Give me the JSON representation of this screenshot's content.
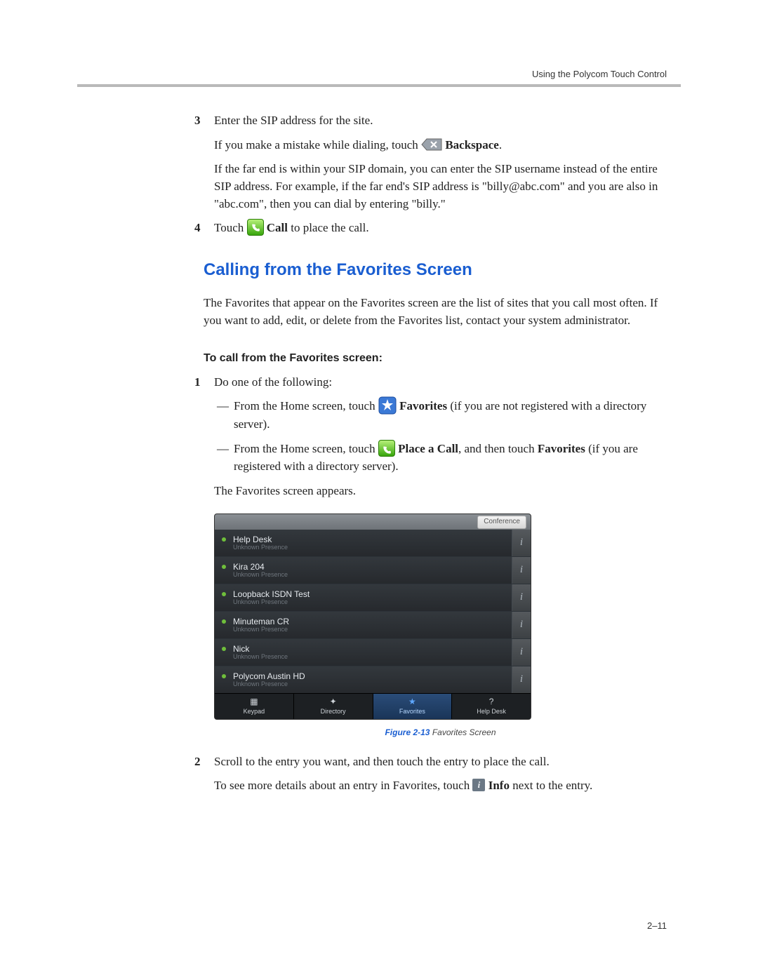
{
  "header": {
    "running": "Using the Polycom Touch Control"
  },
  "step3": {
    "num": "3",
    "p1": "Enter the SIP address for the site.",
    "p2a": "If you make a mistake while dialing, touch ",
    "p2b": "Backspace",
    "p2c": ".",
    "p3": "If the far end is within your SIP domain, you can enter the SIP username instead of the entire SIP address. For example, if the far end's SIP address is \"billy@abc.com\" and you are also in \"abc.com\", then you can dial by entering \"billy.\""
  },
  "step4": {
    "num": "4",
    "a": "Touch ",
    "b": "Call",
    "c": " to place the call."
  },
  "section": {
    "title": "Calling from the Favorites Screen",
    "intro": "The Favorites that appear on the Favorites screen are the list of sites that you call most often. If you want to add, edit, or delete from the Favorites list, contact your system administrator.",
    "subhead": "To call from the Favorites screen:"
  },
  "fstep1": {
    "num": "1",
    "lead": "Do one of the following:",
    "opt1a": "From the Home screen, touch ",
    "opt1b": "Favorites",
    "opt1c": " (if you are not registered with a directory server).",
    "opt2a": "From the Home screen, touch ",
    "opt2b": "Place a Call",
    "opt2c": ", and then touch ",
    "opt2d": "Favorites",
    "opt2e": " (if you are registered with a directory server).",
    "tail": "The Favorites screen appears."
  },
  "favshot": {
    "conference": "Conference",
    "rows": [
      {
        "name": "Help Desk",
        "sub": "Unknown Presence"
      },
      {
        "name": "Kira 204",
        "sub": "Unknown Presence"
      },
      {
        "name": "Loopback ISDN Test",
        "sub": "Unknown Presence"
      },
      {
        "name": "Minuteman CR",
        "sub": "Unknown Presence"
      },
      {
        "name": "Nick",
        "sub": "Unknown Presence"
      },
      {
        "name": "Polycom Austin HD",
        "sub": "Unknown Presence"
      }
    ],
    "tabs": {
      "keypad": "Keypad",
      "directory": "Directory",
      "favorites": "Favorites",
      "helpdesk": "Help Desk"
    }
  },
  "figcap": {
    "label": "Figure 2-13",
    "text": "Favorites Screen"
  },
  "fstep2": {
    "num": "2",
    "p1": "Scroll to the entry you want, and then touch the entry to place the call.",
    "p2a": "To see more details about an entry in Favorites, touch ",
    "p2b": "Info",
    "p2c": " next to the entry."
  },
  "footer": {
    "pagenum": "2–11"
  }
}
